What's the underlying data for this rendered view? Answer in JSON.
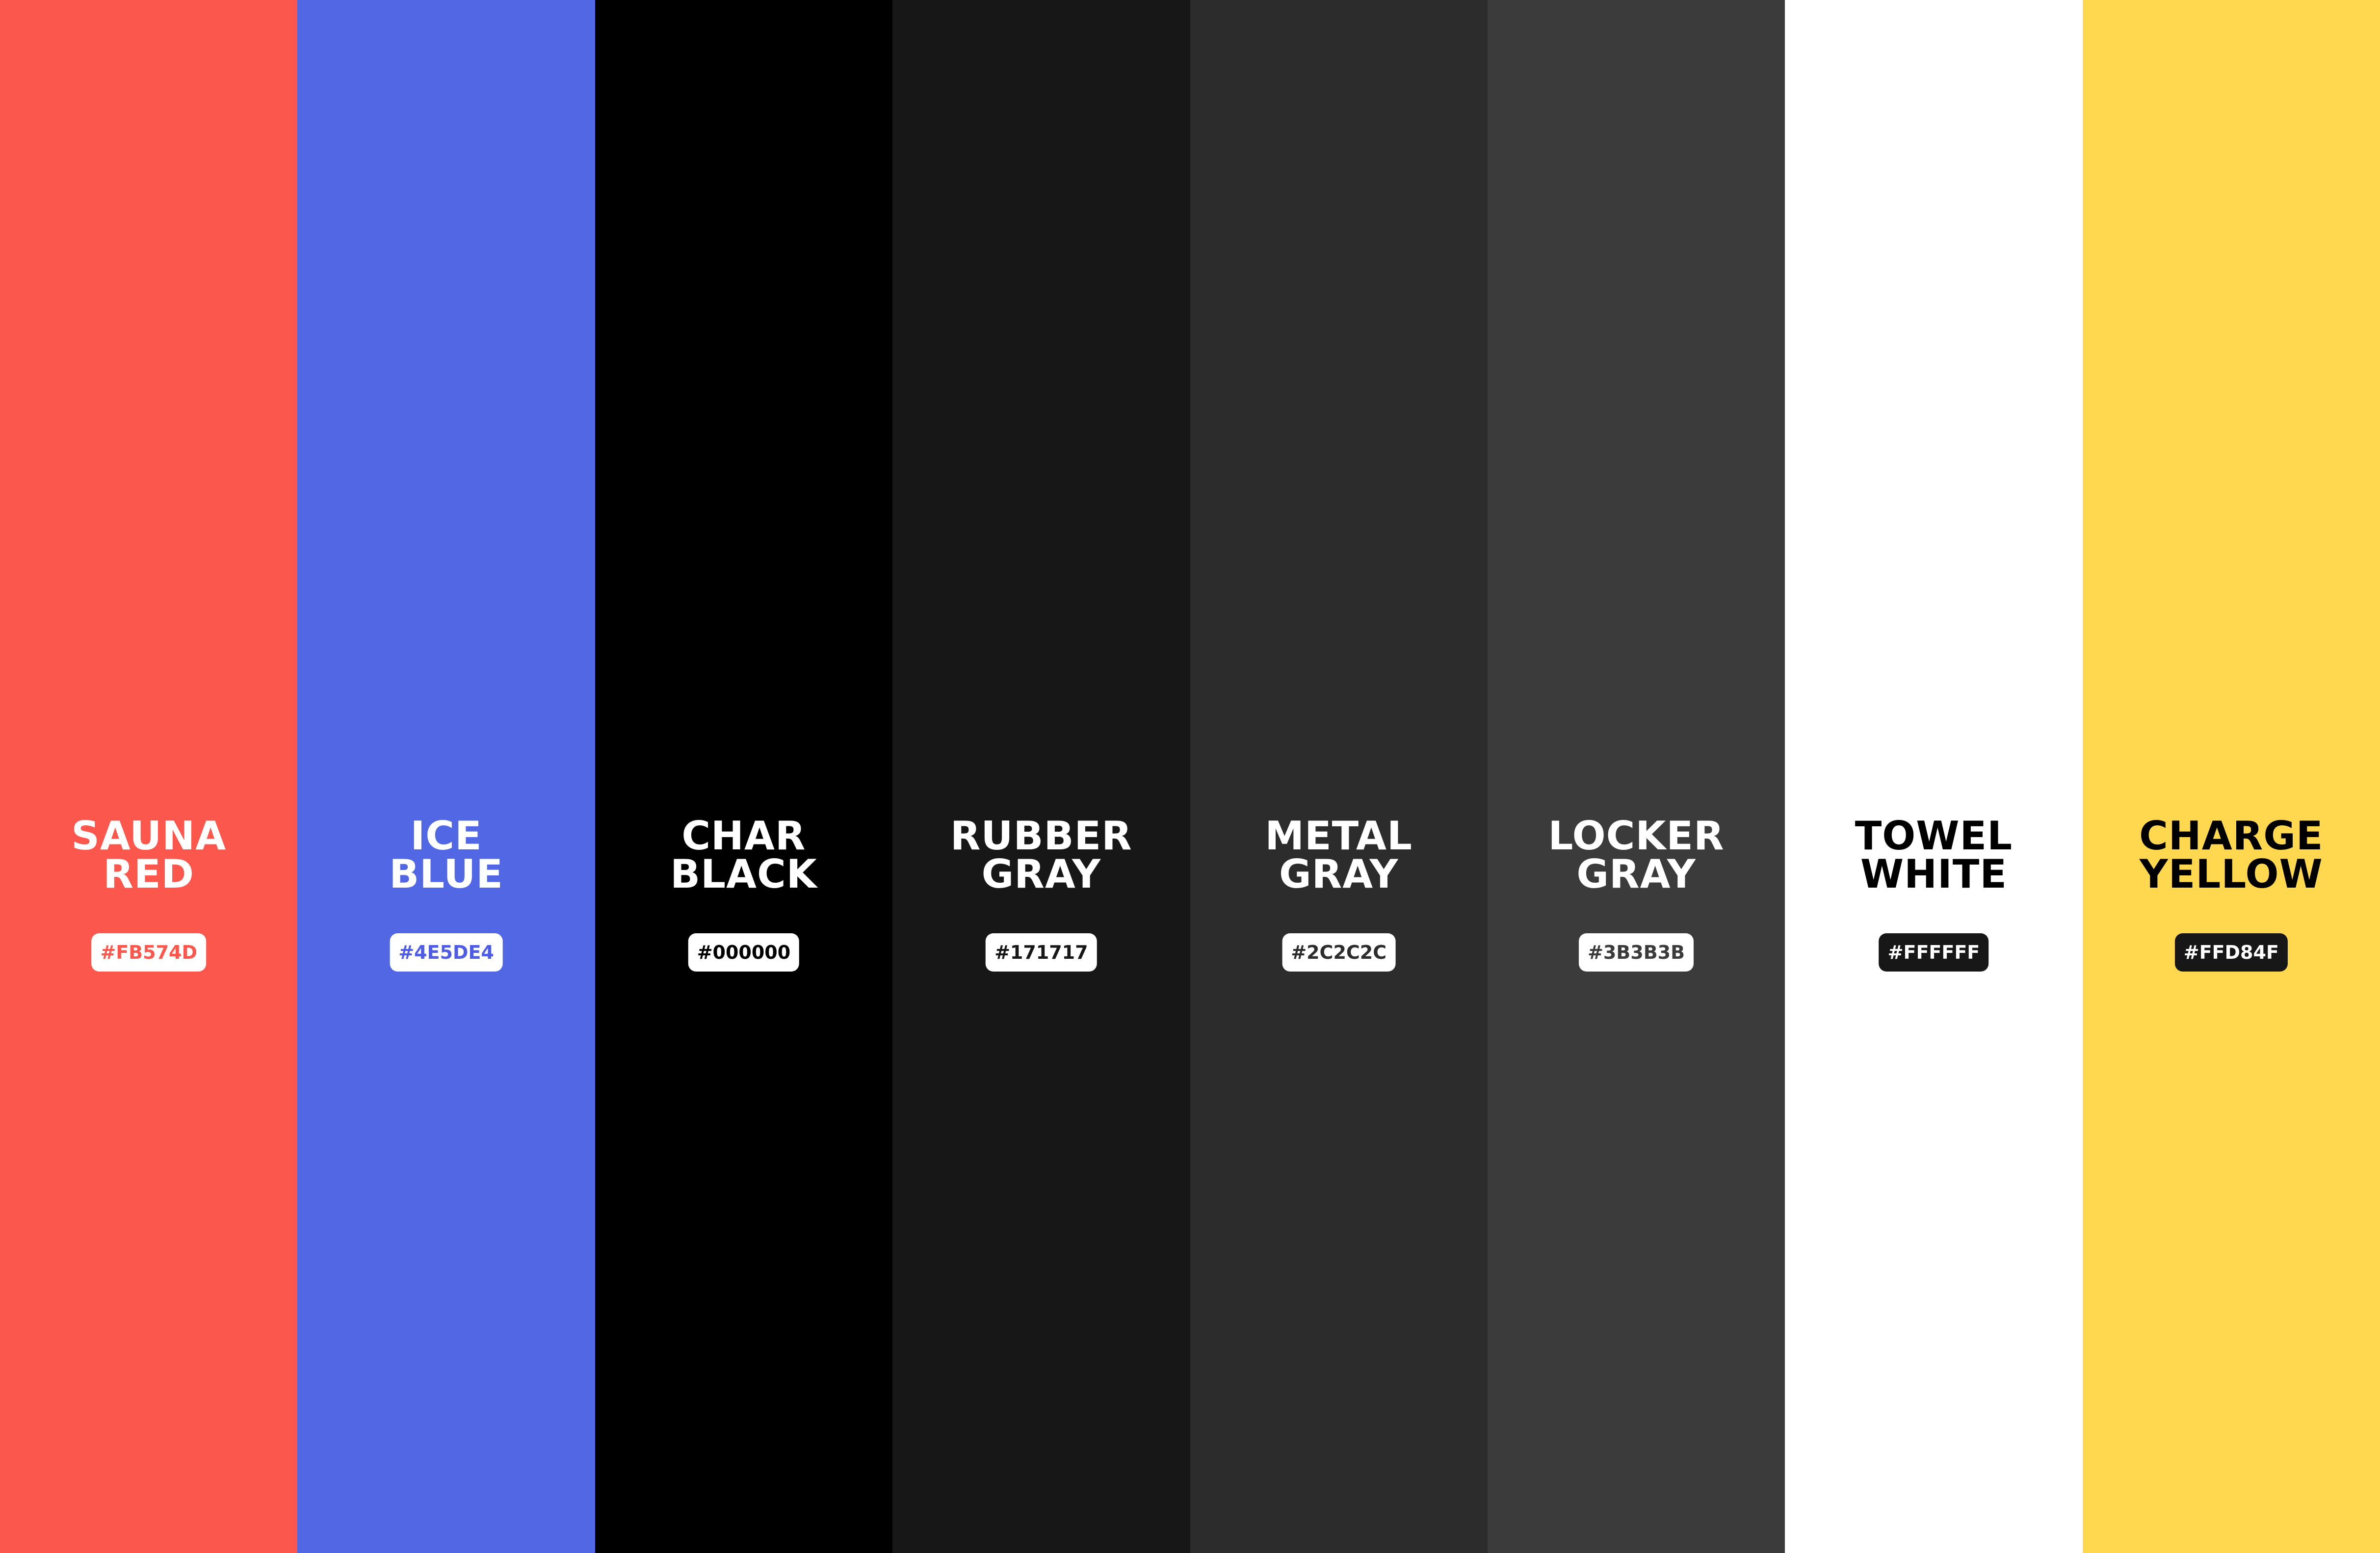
{
  "swatches": [
    {
      "line1": "SAUNA",
      "line2": "RED",
      "hex": "#FB574D",
      "color": "#FB574D",
      "text_color": "#FFFFFF",
      "badge_bg": "#FFFFFF",
      "badge_text": "#FB574D"
    },
    {
      "line1": "ICE",
      "line2": "BLUE",
      "hex": "#4E5DE4",
      "color": "#5167E4",
      "text_color": "#FFFFFF",
      "badge_bg": "#FFFFFF",
      "badge_text": "#4E5DE4"
    },
    {
      "line1": "CHAR",
      "line2": "BLACK",
      "hex": "#000000",
      "color": "#000000",
      "text_color": "#FFFFFF",
      "badge_bg": "#FFFFFF",
      "badge_text": "#000000"
    },
    {
      "line1": "RUBBER",
      "line2": "GRAY",
      "hex": "#171717",
      "color": "#171717",
      "text_color": "#FFFFFF",
      "badge_bg": "#FFFFFF",
      "badge_text": "#171717"
    },
    {
      "line1": "METAL",
      "line2": "GRAY",
      "hex": "#2C2C2C",
      "color": "#2C2C2C",
      "text_color": "#FFFFFF",
      "badge_bg": "#FFFFFF",
      "badge_text": "#2C2C2C"
    },
    {
      "line1": "LOCKER",
      "line2": "GRAY",
      "hex": "#3B3B3B",
      "color": "#3B3B3B",
      "text_color": "#FFFFFF",
      "badge_bg": "#FFFFFF",
      "badge_text": "#3B3B3B"
    },
    {
      "line1": "TOWEL",
      "line2": "WHITE",
      "hex": "#FFFFFF",
      "color": "#FFFFFF",
      "text_color": "#000000",
      "badge_bg": "#171717",
      "badge_text": "#FFFFFF"
    },
    {
      "line1": "CHARGE",
      "line2": "YELLOW",
      "hex": "#FFD84F",
      "color": "#FFD84F",
      "text_color": "#000000",
      "badge_bg": "#171717",
      "badge_text": "#FFFFFF"
    }
  ]
}
